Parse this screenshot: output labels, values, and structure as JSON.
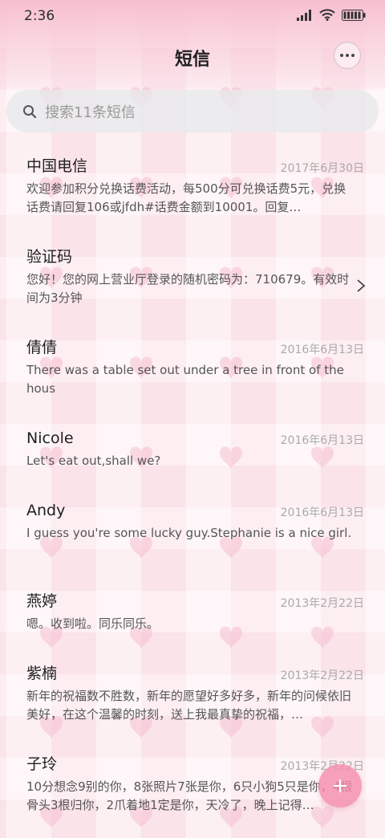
{
  "status_bar": {
    "time": "2:36",
    "icons": [
      "signal-icon",
      "wifi-icon",
      "battery-icon"
    ]
  },
  "header": {
    "title": "短信",
    "more_icon": "more-horizontal-icon"
  },
  "search": {
    "placeholder": "搜索11条短信",
    "icon": "search-icon"
  },
  "conversations": [
    {
      "name": "中国电信",
      "date": "2017年6月30日",
      "preview": "欢迎参加积分兑换话费活动，每500分可兑换话费5元，兑换话费请回复106或jfdh#话费金额到10001。回复…"
    },
    {
      "name": "验证码",
      "date": "",
      "preview": "您好！您的网上营业厅登录的随机密码为：710679。有效时间为3分钟",
      "chevron_icon": "chevron-right-icon"
    },
    {
      "name": "倩倩",
      "date": "2016年6月13日",
      "preview": "There was a table set out under a tree in front of the hous"
    },
    {
      "name": "Nicole",
      "date": "2016年6月13日",
      "preview": "Let's eat out,shall we?"
    },
    {
      "name": "Andy",
      "date": "2016年6月13日",
      "preview": "I guess you're some lucky guy.Stephanie is a nice girl."
    },
    {
      "name": "燕婷",
      "date": "2013年2月22日",
      "preview": "嗯。收到啦。同乐同乐。"
    },
    {
      "name": "紫楠",
      "date": "2013年2月22日",
      "preview": "新年的祝福数不胜数，新年的愿望好多好多，新年的问候依旧美好，在这个温馨的时刻，送上我最真挚的祝福，…"
    },
    {
      "name": "子玲",
      "date": "2013年2月22日",
      "preview": "10分想念9别的你，8张照片7张是你，6只小狗5只是你，4根骨头3根归你，2爪着地1定是你，天冷了，晚上记得…"
    }
  ],
  "fab": {
    "icon": "plus-icon"
  },
  "colors": {
    "background": "#fbe3ea",
    "accent_pink": "#f58caa",
    "heart_pink": "#f7c6d3"
  }
}
